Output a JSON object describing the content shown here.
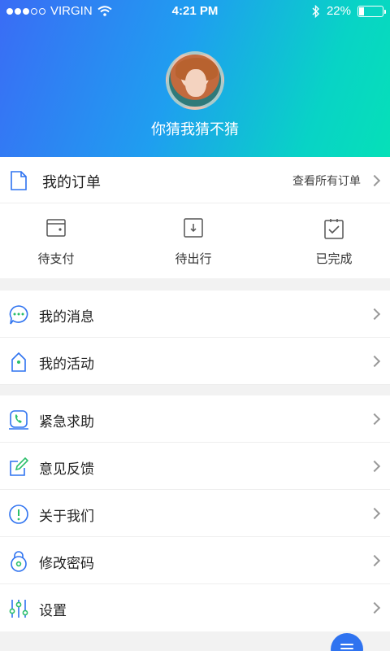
{
  "status_bar": {
    "carrier": "VIRGIN",
    "time": "4:21 PM",
    "battery": "22%",
    "signal_bars_filled": 3,
    "signal_bars_total": 5
  },
  "profile": {
    "username": "你猜我猜不猜"
  },
  "orders": {
    "title": "我的订单",
    "view_all": "查看所有订单",
    "tabs": [
      {
        "label": "待支付",
        "icon": "wallet-icon"
      },
      {
        "label": "待出行",
        "icon": "download-box-icon"
      },
      {
        "label": "已完成",
        "icon": "clipboard-check-icon"
      }
    ]
  },
  "menu_group_1": [
    {
      "label": "我的消息",
      "icon": "message-icon"
    },
    {
      "label": "我的活动",
      "icon": "tag-icon"
    }
  ],
  "menu_group_2": [
    {
      "label": "紧急求助",
      "icon": "phone-icon"
    },
    {
      "label": "意见反馈",
      "icon": "edit-icon"
    },
    {
      "label": "关于我们",
      "icon": "info-icon"
    },
    {
      "label": "修改密码",
      "icon": "lock-icon"
    },
    {
      "label": "设置",
      "icon": "sliders-icon"
    }
  ],
  "colors": {
    "gradient_start": "#3a6cf5",
    "gradient_end": "#06e0b8",
    "accent_blue": "#2f73f0",
    "accent_green": "#2bbf6b"
  }
}
